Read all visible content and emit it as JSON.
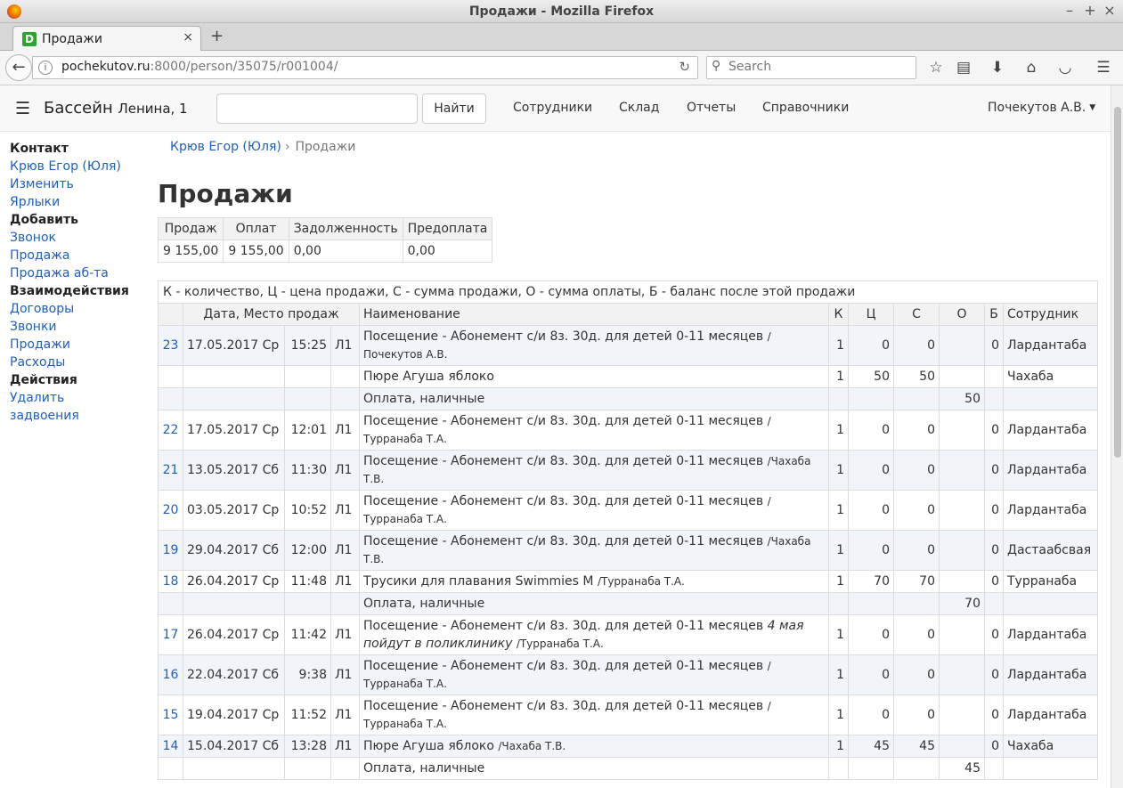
{
  "browser": {
    "window_title": "Продажи - Mozilla Firefox",
    "tab_label": "Продажи",
    "favicon_letter": "D",
    "url_host": "pochekutov.ru",
    "url_rest": ":8000/person/35075/r001004/",
    "search_placeholder": "Search"
  },
  "app": {
    "brand": "Бассейн",
    "brand_sub": "Ленина, 1",
    "find_button": "Найти",
    "nav": [
      "Сотрудники",
      "Склад",
      "Отчеты",
      "Справочники"
    ],
    "user": "Почекутов А.В."
  },
  "sidebar": [
    {
      "label": "Контакт",
      "head": true
    },
    {
      "label": "Крюв Егор (Юля)",
      "head": false
    },
    {
      "label": "Изменить",
      "head": false
    },
    {
      "label": "Ярлыки",
      "head": false
    },
    {
      "label": "Добавить",
      "head": true
    },
    {
      "label": "Звонок",
      "head": false
    },
    {
      "label": "Продажа",
      "head": false
    },
    {
      "label": "Продажа аб-та",
      "head": false
    },
    {
      "label": "Взаимодействия",
      "head": true
    },
    {
      "label": "Договоры",
      "head": false
    },
    {
      "label": "Звонки",
      "head": false
    },
    {
      "label": "Продажи",
      "head": false
    },
    {
      "label": "Расходы",
      "head": false
    },
    {
      "label": "Действия",
      "head": true
    },
    {
      "label": "Удалить",
      "head": false
    },
    {
      "label": "задвоения",
      "head": false
    }
  ],
  "breadcrumb": {
    "parent": "Крюв Егор (Юля)",
    "sep": "›",
    "current": "Продажи"
  },
  "page_title": "Продажи",
  "summary": {
    "headers": [
      "Продаж",
      "Оплат",
      "Задолженность",
      "Предоплата"
    ],
    "values": [
      "9 155,00",
      "9 155,00",
      "0,00",
      "0,00"
    ]
  },
  "sales": {
    "legend": "К - количество, Ц - цена продажи, С - сумма продажи, О - сумма оплаты, Б - баланс после этой продажи",
    "headers": {
      "date": "Дата, Место продаж",
      "name": "Наименование",
      "k": "К",
      "c": "Ц",
      "s": "С",
      "o": "О",
      "b": "Б",
      "emp": "Сотрудник"
    },
    "rows": [
      {
        "type": "sale",
        "no": "23",
        "date": "17.05.2017 Ср",
        "time": "15:25",
        "place": "Л1",
        "name": "Посещение - Абонемент с/и 8з. 30д. для детей 0-11 месяцев",
        "note": "",
        "by": "/Почекутов А.В.",
        "k": "1",
        "c": "0",
        "s": "0",
        "o": "",
        "b": "0",
        "emp": "Лардантаба",
        "band": true,
        "tall": true
      },
      {
        "type": "sale",
        "no": "",
        "date": "",
        "time": "",
        "place": "",
        "name": "Пюре Агуша яблоко",
        "note": "",
        "by": "",
        "k": "1",
        "c": "50",
        "s": "50",
        "o": "",
        "b": "",
        "emp": "Чахаба",
        "band": false,
        "tall": false
      },
      {
        "type": "pay",
        "name": "Оплата, наличные",
        "o": "50",
        "band": true
      },
      {
        "type": "sale",
        "no": "22",
        "date": "17.05.2017 Ср",
        "time": "12:01",
        "place": "Л1",
        "name": "Посещение - Абонемент с/и 8з. 30д. для детей 0-11 месяцев",
        "note": "",
        "by": "/Турранаба Т.А.",
        "k": "1",
        "c": "0",
        "s": "0",
        "o": "",
        "b": "0",
        "emp": "Лардантаба",
        "band": false,
        "tall": true
      },
      {
        "type": "sale",
        "no": "21",
        "date": "13.05.2017 Сб",
        "time": "11:30",
        "place": "Л1",
        "name": "Посещение - Абонемент с/и 8з. 30д. для детей 0-11 месяцев",
        "note": "",
        "by": "/Чахаба Т.В.",
        "k": "1",
        "c": "0",
        "s": "0",
        "o": "",
        "b": "0",
        "emp": "Лардантаба",
        "band": true,
        "tall": true
      },
      {
        "type": "sale",
        "no": "20",
        "date": "03.05.2017 Ср",
        "time": "10:52",
        "place": "Л1",
        "name": "Посещение - Абонемент с/и 8з. 30д. для детей 0-11 месяцев",
        "note": "",
        "by": "/Турранаба Т.А.",
        "k": "1",
        "c": "0",
        "s": "0",
        "o": "",
        "b": "0",
        "emp": "Лардантаба",
        "band": false,
        "tall": true
      },
      {
        "type": "sale",
        "no": "19",
        "date": "29.04.2017 Сб",
        "time": "12:00",
        "place": "Л1",
        "name": "Посещение - Абонемент с/и 8з. 30д. для детей 0-11 месяцев",
        "note": "",
        "by": "/Чахаба Т.В.",
        "k": "1",
        "c": "0",
        "s": "0",
        "o": "",
        "b": "0",
        "emp": "Дастаабсвая",
        "band": true,
        "tall": true
      },
      {
        "type": "sale",
        "no": "18",
        "date": "26.04.2017 Ср",
        "time": "11:48",
        "place": "Л1",
        "name": "Трусики для плавания Swimmies M",
        "note": "",
        "by": "/Турранаба Т.А.",
        "k": "1",
        "c": "70",
        "s": "70",
        "o": "",
        "b": "0",
        "emp": "Турранаба",
        "band": false,
        "tall": false
      },
      {
        "type": "pay",
        "name": "Оплата, наличные",
        "o": "70",
        "band": true
      },
      {
        "type": "sale",
        "no": "17",
        "date": "26.04.2017 Ср",
        "time": "11:42",
        "place": "Л1",
        "name": "Посещение - Абонемент с/и 8з. 30д. для детей 0-11 месяцев",
        "note": "4 мая пойдут в поликлинику",
        "by": "/Турранаба Т.А.",
        "k": "1",
        "c": "0",
        "s": "0",
        "o": "",
        "b": "0",
        "emp": "Лардантаба",
        "band": false,
        "tall": true
      },
      {
        "type": "sale",
        "no": "16",
        "date": "22.04.2017 Сб",
        "time": "9:38",
        "place": "Л1",
        "name": "Посещение - Абонемент с/и 8з. 30д. для детей 0-11 месяцев",
        "note": "",
        "by": "/Турранаба Т.А.",
        "k": "1",
        "c": "0",
        "s": "0",
        "o": "",
        "b": "0",
        "emp": "Лардантаба",
        "band": true,
        "tall": true
      },
      {
        "type": "sale",
        "no": "15",
        "date": "19.04.2017 Ср",
        "time": "11:52",
        "place": "Л1",
        "name": "Посещение - Абонемент с/и 8з. 30д. для детей 0-11 месяцев",
        "note": "",
        "by": "/Турранаба Т.А.",
        "k": "1",
        "c": "0",
        "s": "0",
        "o": "",
        "b": "0",
        "emp": "Лардантаба",
        "band": false,
        "tall": true
      },
      {
        "type": "sale",
        "no": "14",
        "date": "15.04.2017 Сб",
        "time": "13:28",
        "place": "Л1",
        "name": "Пюре Агуша яблоко",
        "note": "",
        "by": "/Чахаба Т.В.",
        "k": "1",
        "c": "45",
        "s": "45",
        "o": "",
        "b": "0",
        "emp": "Чахаба",
        "band": true,
        "tall": false
      },
      {
        "type": "pay",
        "name": "Оплата, наличные",
        "o": "45",
        "band": false
      }
    ]
  }
}
